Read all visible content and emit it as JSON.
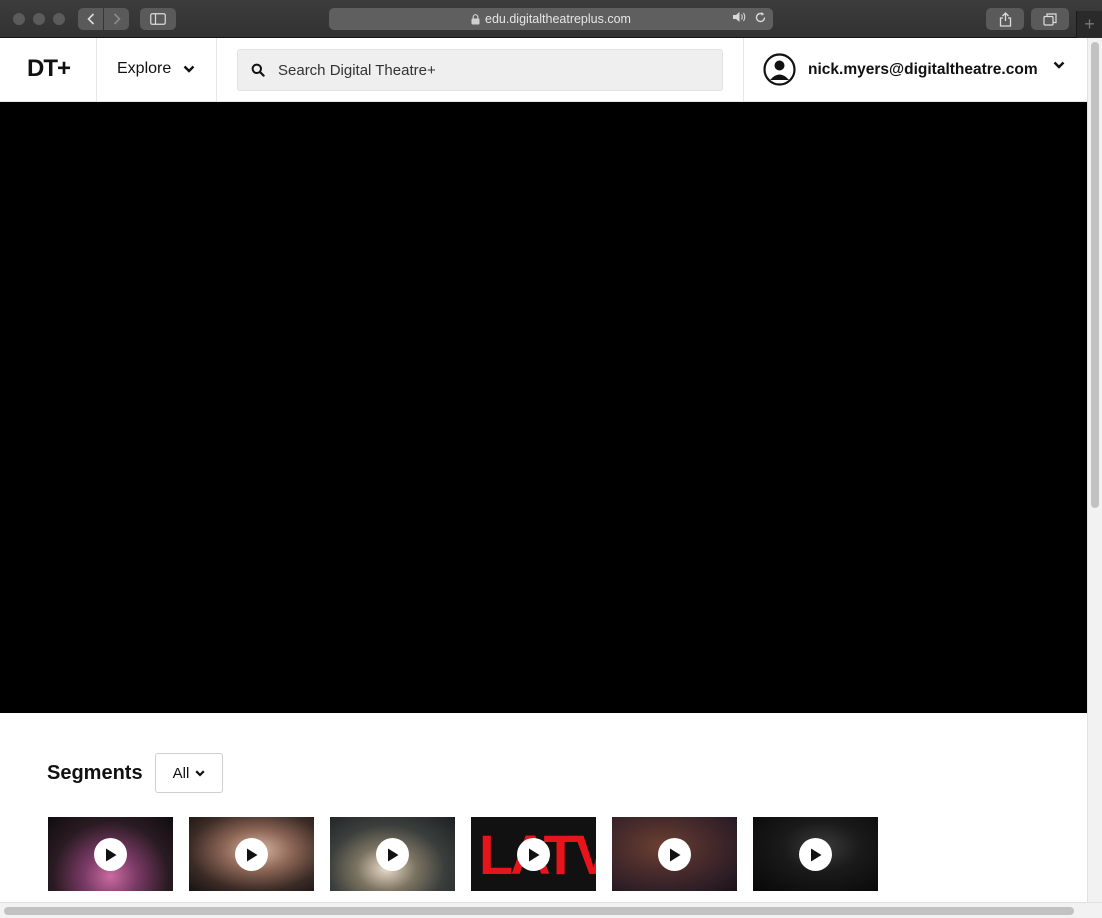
{
  "browser": {
    "url": "edu.digitaltheatreplus.com",
    "new_tab_label": "+"
  },
  "header": {
    "logo": "DT+",
    "explore_label": "Explore",
    "search_placeholder": "Search Digital Theatre+",
    "account_email": "nick.myers@digitaltheatre.com"
  },
  "segments": {
    "title": "Segments",
    "filter_value": "All",
    "thumbnails": [
      {
        "name": "segment-1"
      },
      {
        "name": "segment-2"
      },
      {
        "name": "segment-3"
      },
      {
        "name": "segment-4",
        "overlay_text": "LATV"
      },
      {
        "name": "segment-5"
      },
      {
        "name": "segment-6"
      }
    ]
  },
  "colors": {
    "accent_red": "#e8141c",
    "text_dark": "#111111",
    "video_bg": "#000000"
  }
}
